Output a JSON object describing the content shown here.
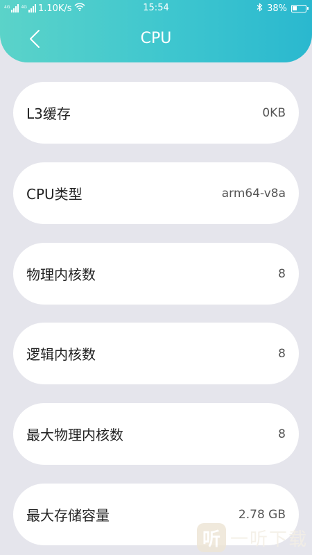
{
  "status_bar": {
    "network_speed": "1.10K/s",
    "network_tag_1": "4G",
    "network_tag_2": "4G",
    "time": "15:54",
    "battery": "38%",
    "battery_level": 0.38
  },
  "header": {
    "title": "CPU"
  },
  "items": [
    {
      "label": "L3缓存",
      "value": "0KB"
    },
    {
      "label": "CPU类型",
      "value": "arm64-v8a"
    },
    {
      "label": "物理内核数",
      "value": "8"
    },
    {
      "label": "逻辑内核数",
      "value": "8"
    },
    {
      "label": "最大物理内核数",
      "value": "8"
    },
    {
      "label": "最大存储容量",
      "value": "2.78 GB"
    }
  ],
  "watermark": {
    "text": "一听下载",
    "icon_glyph": "听"
  },
  "colors": {
    "header_start": "#5bd3c9",
    "header_end": "#2ab8cf",
    "background": "#e5e5ec"
  }
}
